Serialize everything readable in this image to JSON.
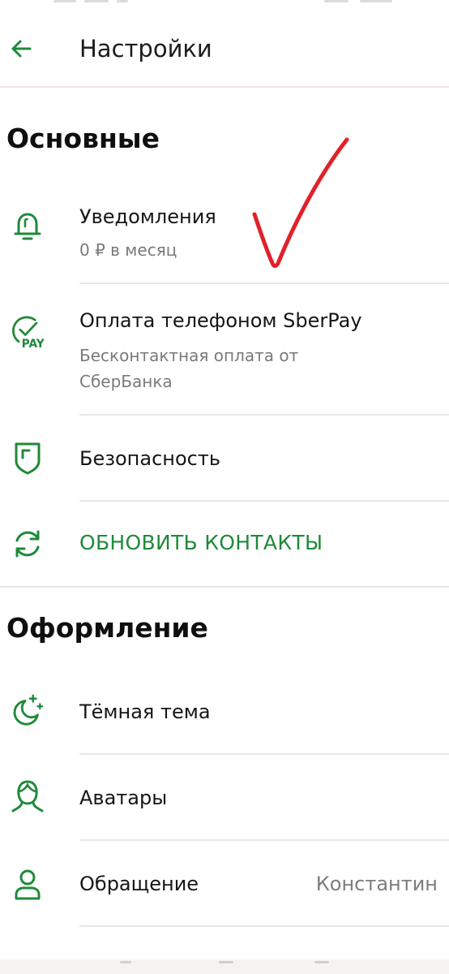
{
  "header": {
    "title": "Настройки"
  },
  "sections": {
    "main": {
      "title": "Основные",
      "notifications": {
        "label": "Уведомления",
        "sub": "0 ₽ в месяц"
      },
      "sberpay": {
        "label": "Оплата телефоном SberPay",
        "sub": "Бесконтактная оплата от СберБанка",
        "icon_text": "PAY"
      },
      "security": {
        "label": "Безопасность"
      },
      "update_contacts": {
        "label": "ОБНОВИТЬ КОНТАКТЫ"
      }
    },
    "appearance": {
      "title": "Оформление",
      "dark_theme": {
        "label": "Тёмная тема"
      },
      "avatars": {
        "label": "Аватары"
      },
      "greeting": {
        "label": "Обращение",
        "value": "Константин"
      }
    }
  },
  "colors": {
    "accent": "#1f8a3a",
    "annotation": "#e3202a",
    "text": "#161616",
    "secondary_text": "#7a7a7a",
    "divider": "#e7e7e7"
  },
  "icons": {
    "back": "arrow-left-icon",
    "notifications": "bell-icon",
    "sberpay": "sberpay-icon",
    "security": "shield-icon",
    "update_contacts": "refresh-icon",
    "dark_theme": "moon-stars-icon",
    "avatars": "avatar-silhouette-icon",
    "greeting": "user-icon"
  }
}
